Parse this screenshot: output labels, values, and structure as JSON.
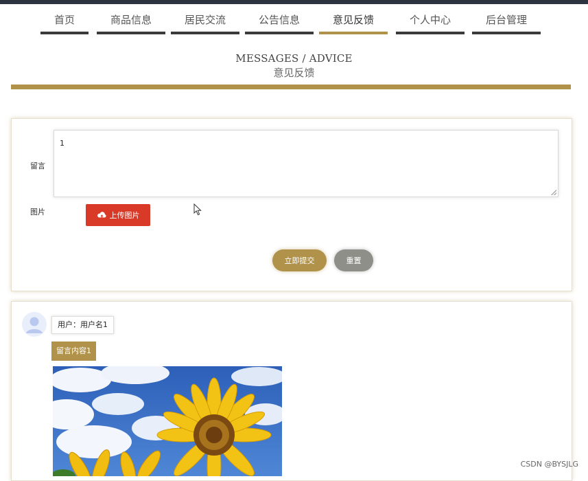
{
  "nav": {
    "items": [
      {
        "label": "首页"
      },
      {
        "label": "商品信息"
      },
      {
        "label": "居民交流"
      },
      {
        "label": "公告信息"
      },
      {
        "label": "意见反馈"
      },
      {
        "label": "个人中心"
      },
      {
        "label": "后台管理"
      }
    ],
    "active_index": 4
  },
  "heading": {
    "en": "MESSAGES / ADVICE",
    "cn": "意见反馈"
  },
  "form": {
    "message_label": "留言",
    "message_value": "1",
    "image_label": "图片",
    "upload_label": "上传图片",
    "submit_label": "立即提交",
    "reset_label": "重置"
  },
  "message": {
    "user_text": "用户：用户名1",
    "content_text": "留言内容1"
  },
  "watermark": "CSDN @BYSJLG",
  "colors": {
    "accent": "#b0924a",
    "nav_bar": "#3a3a3a",
    "upload_red": "#d93a27",
    "reset_gray": "#8f8f8a"
  },
  "icons": [
    "cloud-upload-icon",
    "avatar-icon",
    "mouse-cursor-icon"
  ]
}
